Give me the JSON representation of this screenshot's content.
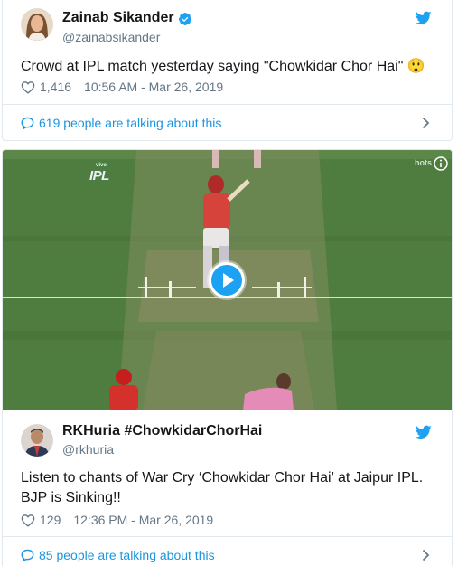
{
  "tweet1": {
    "name": "Zainab Sikander",
    "handle": "@zainabsikander",
    "text": "Crowd at IPL match yesterday saying \"Chowkidar Chor Hai\" 😲",
    "likes": "1,416",
    "timestamp": "10:56 AM - Mar 26, 2019",
    "talking": "619 people are talking about this"
  },
  "video": {
    "logo_brand": "vivo",
    "logo_text": "IPL",
    "watermark": "hots"
  },
  "tweet2": {
    "name": "RKHuria #ChowkidarChorHai",
    "handle": "@rkhuria",
    "text": "Listen to chants of War Cry ‘Chowkidar Chor Hai’ at Jaipur IPL. BJP is Sinking!!",
    "likes": "129",
    "timestamp": "12:36 PM - Mar 26, 2019",
    "talking": "85 people are talking about this"
  },
  "colors": {
    "twitter_blue": "#1da1f2",
    "link_blue": "#1b95e0",
    "text_gray": "#657786",
    "border": "#e1e8ed",
    "pitch_green": "#4d7a3d"
  },
  "icons": [
    "verified-badge-icon",
    "twitter-bird-icon",
    "heart-icon",
    "speech-bubble-icon",
    "chevron-right-icon",
    "play-icon",
    "info-icon"
  ]
}
